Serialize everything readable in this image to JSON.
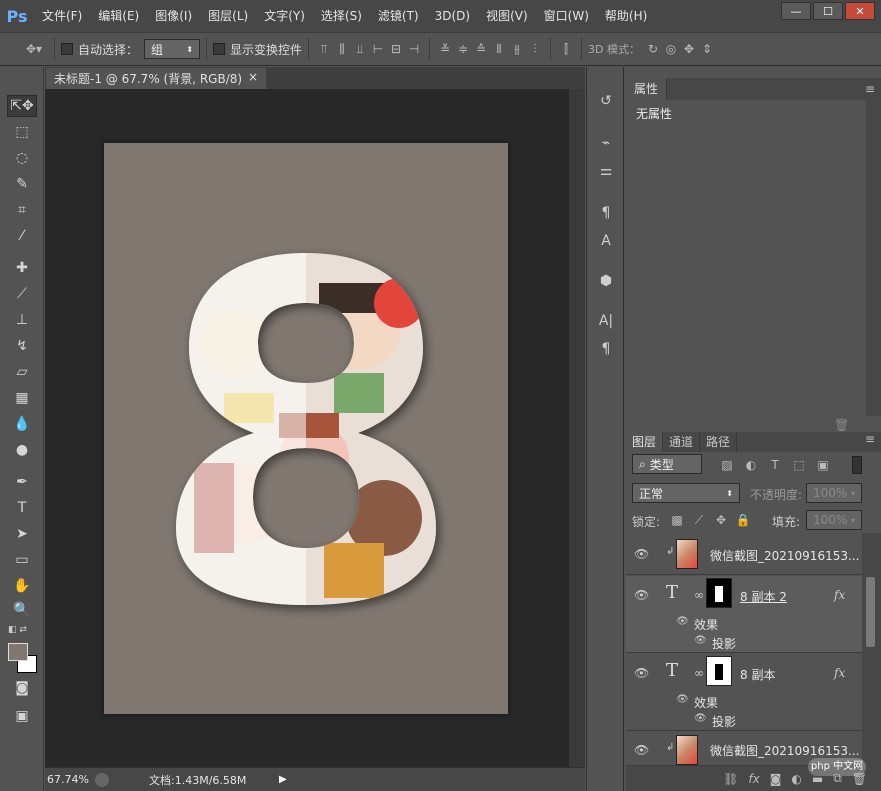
{
  "app": {
    "logo": "Ps"
  },
  "menu": [
    "文件(F)",
    "编辑(E)",
    "图像(I)",
    "图层(L)",
    "文字(Y)",
    "选择(S)",
    "滤镜(T)",
    "3D(D)",
    "视图(V)",
    "窗口(W)",
    "帮助(H)"
  ],
  "window_buttons": [
    "—",
    "☐",
    "✕"
  ],
  "options": {
    "auto_select_label": "自动选择：",
    "auto_select_value": "组",
    "show_transform_label": "显示变换控件",
    "mode_3d_label": "3D 模式："
  },
  "document": {
    "tab_title": "未标题-1 @ 67.7% (背景, RGB/8) *",
    "close": "×",
    "zoom": "67.74%",
    "doc_info": "文档:1.43M/6.58M"
  },
  "properties": {
    "tab": "属性",
    "content": "无属性"
  },
  "layers_panel": {
    "tabs": [
      "图层",
      "通道",
      "路径"
    ],
    "filter_label": "类型",
    "blend_mode": "正常",
    "opacity_label": "不透明度:",
    "opacity_value": "100%",
    "lock_label": "锁定:",
    "fill_label": "填充:",
    "fill_value": "100%",
    "layers": [
      {
        "name": "微信截图_20210916153...",
        "type": "image",
        "clipped": true
      },
      {
        "name": "8 副本 2",
        "type": "text",
        "fx": true,
        "effects_label": "效果",
        "effect": "投影"
      },
      {
        "name": "8 副本",
        "type": "text",
        "fx": true,
        "effects_label": "效果",
        "effect": "投影"
      },
      {
        "name": "微信截图_20210916153...",
        "type": "image",
        "clipped": true
      }
    ]
  },
  "watermark": "php 中文网",
  "colors": {
    "doc_bg": "#7f7770",
    "canvas_bg": "#282828",
    "panel": "#535353",
    "accent": "#6ab2ff"
  }
}
